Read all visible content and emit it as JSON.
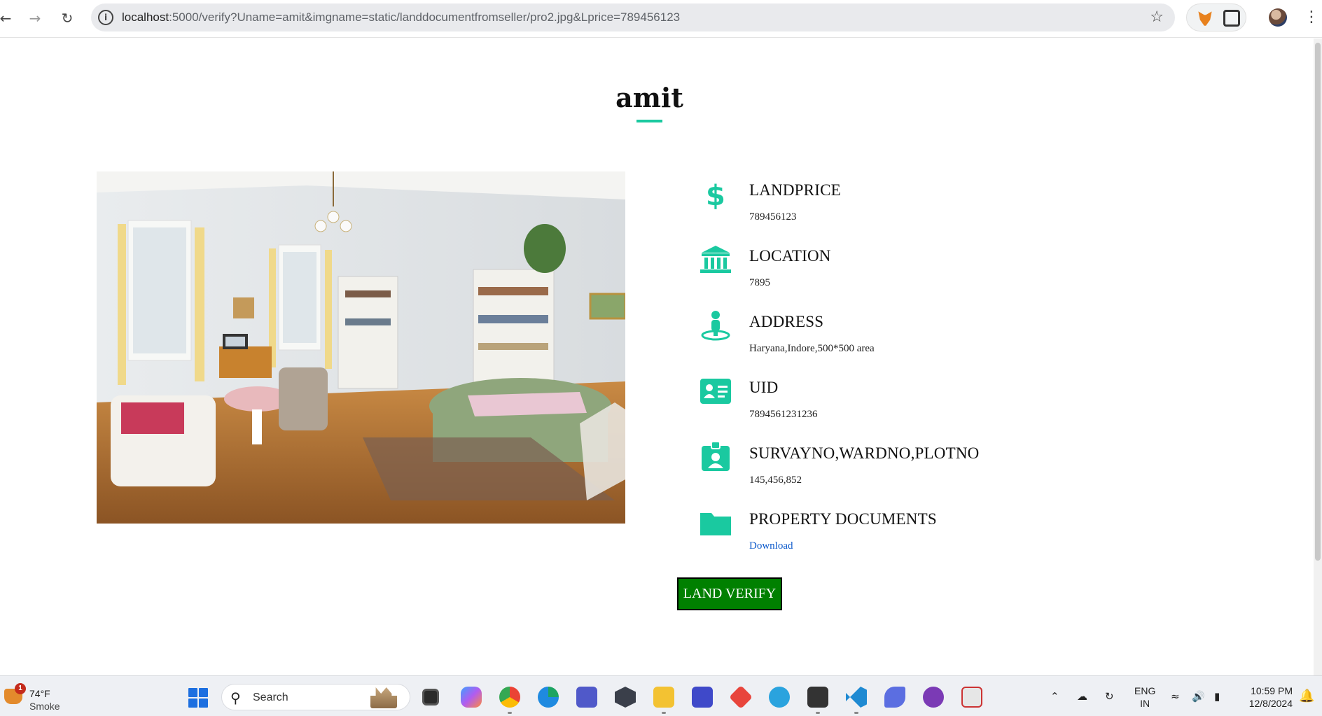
{
  "browser": {
    "url_host": "localhost",
    "url_rest": ":5000/verify?Uname=amit&imgname=static/landdocumentfromseller/pro2.jpg&Lprice=789456123"
  },
  "page": {
    "title": "amit",
    "details": [
      {
        "label": "LANDPRICE",
        "value": "789456123",
        "icon": "dollar-icon"
      },
      {
        "label": "LOCATION",
        "value": "7895",
        "icon": "bank-icon"
      },
      {
        "label": "ADDRESS",
        "value": "Haryana,Indore,500*500 area",
        "icon": "person-pin-icon"
      },
      {
        "label": "UID",
        "value": "7894561231236",
        "icon": "id-card-icon"
      },
      {
        "label": "SURVAYNO,WARDNO,PLOTNO",
        "value": "145,456,852",
        "icon": "badge-icon"
      },
      {
        "label": "PROPERTY DOCUMENTS",
        "value": "Download",
        "icon": "folder-icon"
      }
    ],
    "verify_button": "LAND VERIFY",
    "accent_color": "#1ac9a0",
    "button_color": "#008000"
  },
  "taskbar": {
    "weather_temp": "74°F",
    "weather_desc": "Smoke",
    "weather_badge": "1",
    "search_label": "Search",
    "lang_line1": "ENG",
    "lang_line2": "IN",
    "time": "10:59 PM",
    "date": "12/8/2024"
  }
}
